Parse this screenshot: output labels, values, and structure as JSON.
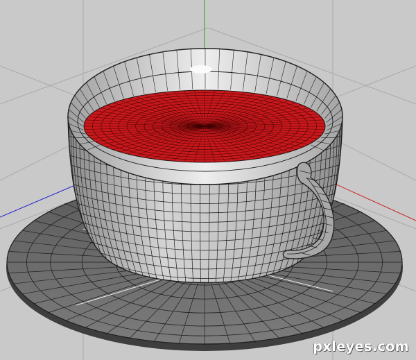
{
  "watermark": {
    "text": "pxleyes.com"
  },
  "colors": {
    "background": "#c9c9c9",
    "grid_line": "#a9a9a9",
    "axis_y": "#20a020",
    "axis_x": "#cc2020",
    "axis_z": "#2020cc",
    "saucer_top": "#6e6e6e",
    "cup_body": "#b4b4b4",
    "cup_inner": "#d0d0d0",
    "liquid": "#c8181c",
    "wire": "#1e1e1e"
  }
}
